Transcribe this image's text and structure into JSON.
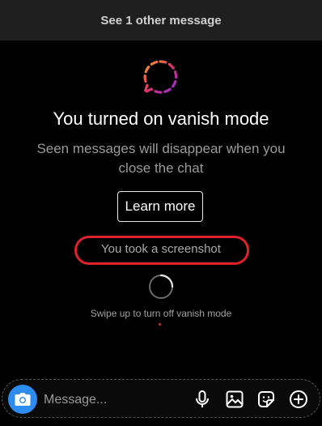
{
  "banner": {
    "label": "See 1 other message"
  },
  "vanish": {
    "title": "You turned on vanish mode",
    "description": "Seen messages will disappear when you close the chat",
    "learn_more_label": "Learn more",
    "screenshot_notice": "You took a screenshot",
    "swipe_hint": "Swipe up to turn off vanish mode"
  },
  "composer": {
    "placeholder": "Message...",
    "icons": [
      "camera-icon",
      "microphone-icon",
      "gallery-icon",
      "sticker-icon",
      "plus-icon"
    ]
  },
  "colors": {
    "accent_blue": "#2d8cf0",
    "highlight_red": "#e0202a",
    "vanish_gradient_start": "#f5a623",
    "vanish_gradient_end": "#8e2de2"
  }
}
